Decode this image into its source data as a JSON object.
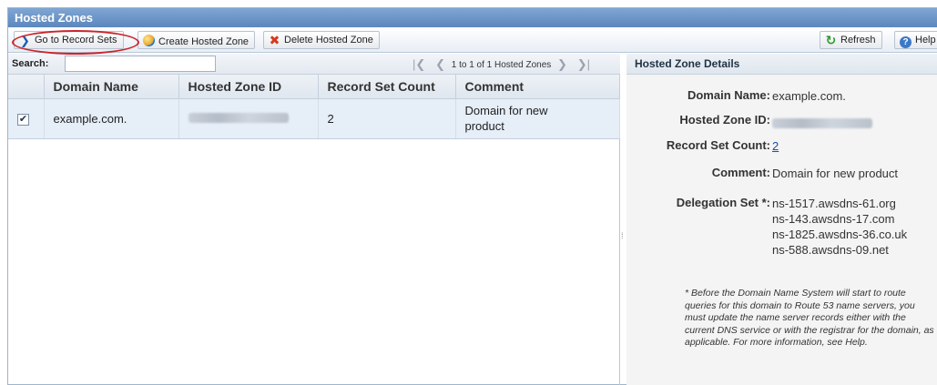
{
  "panel": {
    "title": "Hosted Zones"
  },
  "toolbar": {
    "go_to_record_sets": "Go to Record Sets",
    "create_hosted_zone": "Create Hosted Zone",
    "delete_hosted_zone": "Delete Hosted Zone",
    "refresh": "Refresh",
    "help": "Help"
  },
  "search": {
    "label": "Search:",
    "value": ""
  },
  "pager": {
    "summary": "1 to 1 of 1 Hosted Zones"
  },
  "table": {
    "headers": [
      "Domain Name",
      "Hosted Zone ID",
      "Record Set Count",
      "Comment"
    ],
    "rows": [
      {
        "checked": true,
        "domain_name": "example.com.",
        "record_set_count": "2",
        "comment": "Domain for new product"
      }
    ]
  },
  "details": {
    "title": "Hosted Zone Details",
    "domain_name_label": "Domain Name:",
    "domain_name": "example.com.",
    "hosted_zone_id_label": "Hosted Zone ID:",
    "record_set_count_label": "Record Set Count:",
    "record_set_count": "2",
    "comment_label": "Comment:",
    "comment": "Domain for new product",
    "delegation_label": "Delegation Set *:",
    "name_servers": [
      "ns-1517.awsdns-61.org",
      "ns-143.awsdns-17.com",
      "ns-1825.awsdns-36.co.uk",
      "ns-588.awsdns-09.net"
    ],
    "note": "* Before the Domain Name System will start to route queries for this domain to Route 53 name servers, you must update the name server records either with the current DNS service or with the registrar for the domain, as applicable. For more information, see Help."
  },
  "icons": {
    "go": "chevron-right-icon",
    "create": "globe-icon",
    "delete": "red-x-icon",
    "refresh": "refresh-icon",
    "help": "help-icon"
  },
  "colors": {
    "title_bar": "#6b93c7",
    "highlight_ring": "#c9252c",
    "selected_row": "#e6eef8"
  }
}
